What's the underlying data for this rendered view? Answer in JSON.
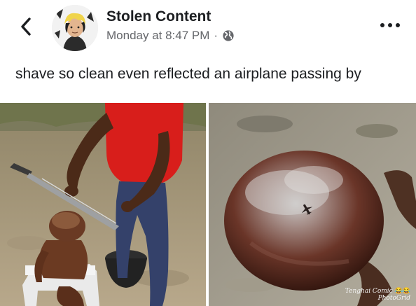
{
  "post": {
    "author": "Stolen Content",
    "timestamp": "Monday at 8:47 PM",
    "separator": "·",
    "caption": "shave so clean even reflected an airplane passing by"
  },
  "icons": {
    "back": "chevron-left-icon",
    "audience": "globe-icon",
    "more": "more-horizontal-icon"
  },
  "photos": {
    "left": "man-with-machete-shaving-child",
    "right": "shaved-head-closeup-airplane-reflection",
    "watermark_line1": "Tenghai Comic",
    "watermark_emoji": "😂😂",
    "watermark_line2": "PhotoGrid"
  },
  "colors": {
    "name": "#1c1e21",
    "meta": "#65676b",
    "background": "#ffffff"
  }
}
